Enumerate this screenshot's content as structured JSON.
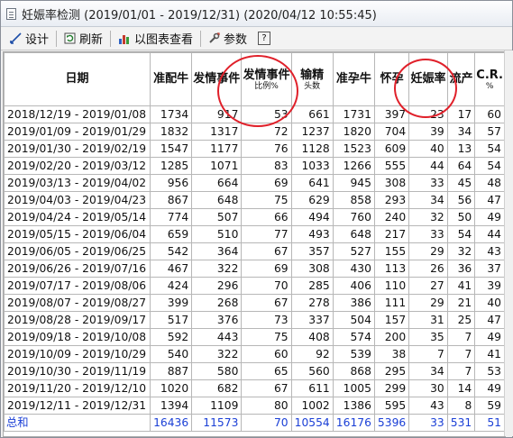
{
  "window": {
    "title": "妊娠率检测 (2019/01/01 - 2019/12/31) (2020/04/12 10:55:45)",
    "title_icon": "document-icon"
  },
  "toolbar": {
    "design_label": "设计",
    "refresh_label": "刷新",
    "chart_view_label": "以图表查看",
    "params_label": "参数",
    "help_label": "?"
  },
  "table": {
    "columns": [
      {
        "label": "日期",
        "sub": ""
      },
      {
        "label": "准配牛",
        "sub": ""
      },
      {
        "label": "发情事件",
        "sub": ""
      },
      {
        "label": "发情事件",
        "sub": "比例%"
      },
      {
        "label": "输精",
        "sub": "头数"
      },
      {
        "label": "准孕牛",
        "sub": ""
      },
      {
        "label": "怀孕",
        "sub": ""
      },
      {
        "label": "妊娠率",
        "sub": ""
      },
      {
        "label": "流产",
        "sub": ""
      },
      {
        "label": "C.R.",
        "sub": "%"
      }
    ],
    "rows": [
      [
        "2018/12/19 - 2019/01/08",
        "1734",
        "917",
        "53",
        "661",
        "1731",
        "397",
        "23",
        "17",
        "60"
      ],
      [
        "2019/01/09 - 2019/01/29",
        "1832",
        "1317",
        "72",
        "1237",
        "1820",
        "704",
        "39",
        "34",
        "57"
      ],
      [
        "2019/01/30 - 2019/02/19",
        "1547",
        "1177",
        "76",
        "1128",
        "1523",
        "609",
        "40",
        "13",
        "54"
      ],
      [
        "2019/02/20 - 2019/03/12",
        "1285",
        "1071",
        "83",
        "1033",
        "1266",
        "555",
        "44",
        "64",
        "54"
      ],
      [
        "2019/03/13 - 2019/04/02",
        "956",
        "664",
        "69",
        "641",
        "945",
        "308",
        "33",
        "45",
        "48"
      ],
      [
        "2019/04/03 - 2019/04/23",
        "867",
        "648",
        "75",
        "629",
        "858",
        "293",
        "34",
        "56",
        "47"
      ],
      [
        "2019/04/24 - 2019/05/14",
        "774",
        "507",
        "66",
        "494",
        "760",
        "240",
        "32",
        "50",
        "49"
      ],
      [
        "2019/05/15 - 2019/06/04",
        "659",
        "510",
        "77",
        "493",
        "648",
        "217",
        "33",
        "54",
        "44"
      ],
      [
        "2019/06/05 - 2019/06/25",
        "542",
        "364",
        "67",
        "357",
        "527",
        "155",
        "29",
        "32",
        "43"
      ],
      [
        "2019/06/26 - 2019/07/16",
        "467",
        "322",
        "69",
        "308",
        "430",
        "113",
        "26",
        "36",
        "37"
      ],
      [
        "2019/07/17 - 2019/08/06",
        "424",
        "296",
        "70",
        "285",
        "406",
        "110",
        "27",
        "41",
        "39"
      ],
      [
        "2019/08/07 - 2019/08/27",
        "399",
        "268",
        "67",
        "278",
        "386",
        "111",
        "29",
        "21",
        "40"
      ],
      [
        "2019/08/28 - 2019/09/17",
        "517",
        "376",
        "73",
        "337",
        "504",
        "157",
        "31",
        "25",
        "47"
      ],
      [
        "2019/09/18 - 2019/10/08",
        "592",
        "443",
        "75",
        "408",
        "574",
        "200",
        "35",
        "7",
        "49"
      ],
      [
        "2019/10/09 - 2019/10/29",
        "540",
        "322",
        "60",
        "92",
        "539",
        "38",
        "7",
        "7",
        "41"
      ],
      [
        "2019/10/30 - 2019/11/19",
        "887",
        "580",
        "65",
        "560",
        "868",
        "295",
        "34",
        "7",
        "53"
      ],
      [
        "2019/11/20 - 2019/12/10",
        "1020",
        "682",
        "67",
        "611",
        "1005",
        "299",
        "30",
        "14",
        "49"
      ],
      [
        "2019/12/11 - 2019/12/31",
        "1394",
        "1109",
        "80",
        "1002",
        "1386",
        "595",
        "43",
        "8",
        "59"
      ]
    ],
    "total": [
      "总和",
      "16436",
      "11573",
      "70",
      "10554",
      "16176",
      "5396",
      "33",
      "531",
      "51"
    ]
  },
  "colors": {
    "highlight": "#e0202a",
    "total_text": "#1a3fd6"
  }
}
